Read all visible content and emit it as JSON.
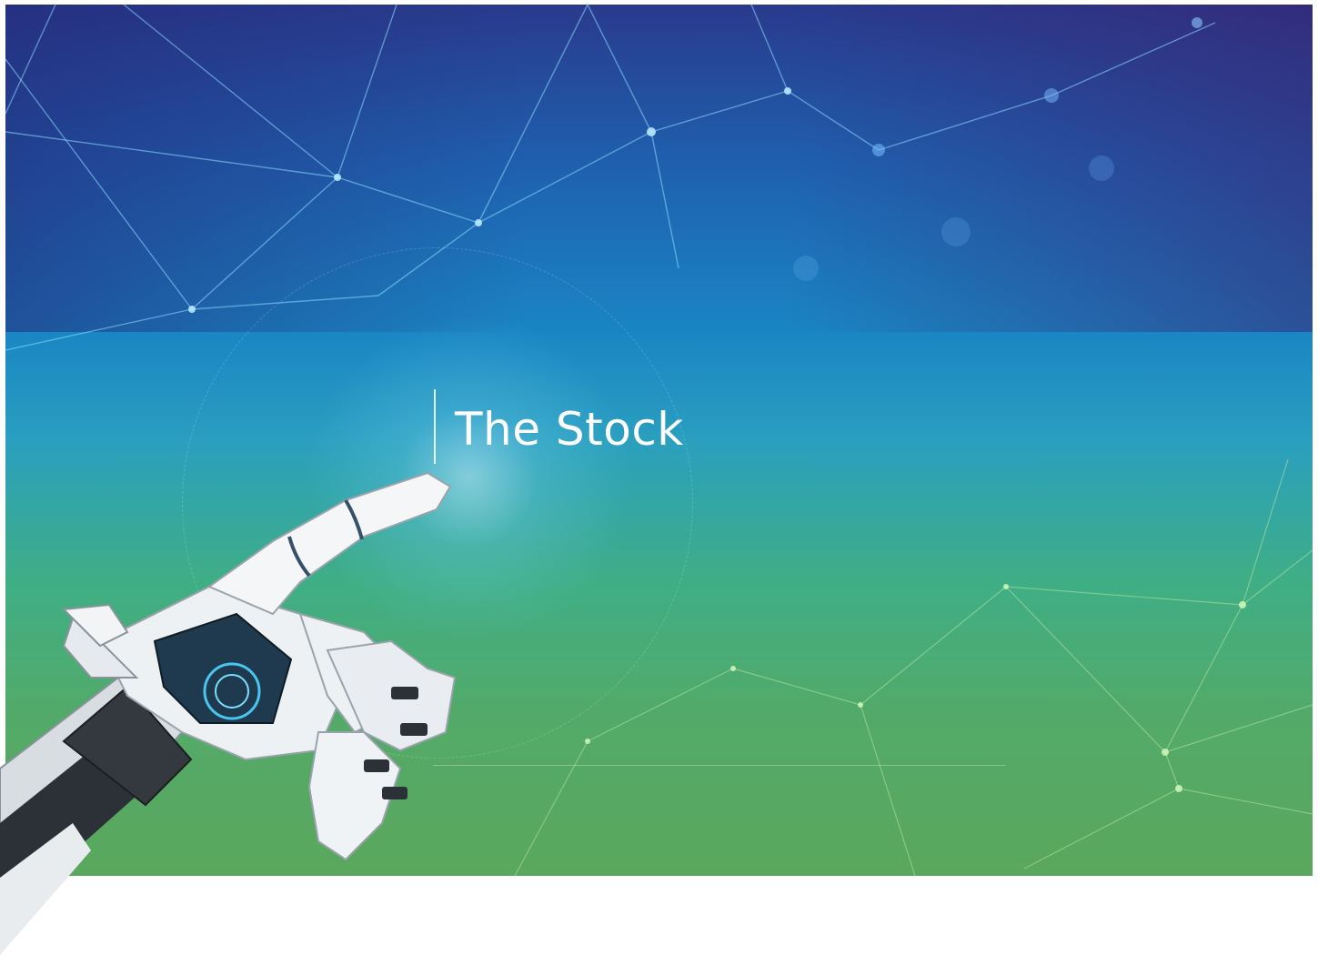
{
  "slide": {
    "title": "The Stock"
  },
  "colors": {
    "gradient_top": "#2a3a8c",
    "gradient_mid": "#1a86c4",
    "gradient_bottom": "#5aa75e",
    "title_text": "#ffffff",
    "background": "#ffffff"
  },
  "images": {
    "hero": "network-background",
    "hand": "robot-hand-pointing"
  }
}
